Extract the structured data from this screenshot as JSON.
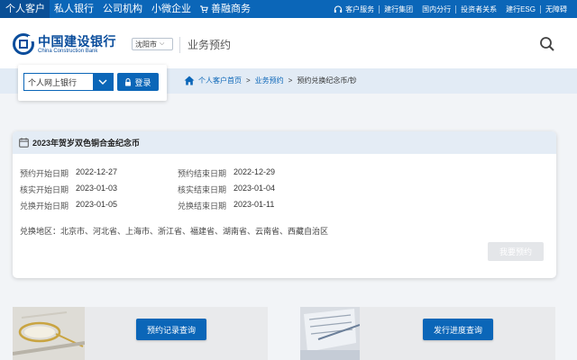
{
  "topnav": {
    "items": [
      "个人客户",
      "私人银行",
      "公司机构",
      "小微企业",
      "善融商务"
    ],
    "right_links": [
      "客户服务",
      "建行集团",
      "国内分行",
      "投资者关系",
      "建行ESG",
      "无障碍"
    ]
  },
  "header": {
    "logo_cn": "中国建设银行",
    "logo_en": "China Construction Bank",
    "city": "沈阳市",
    "section_title": "业务预约"
  },
  "login": {
    "select_value": "个人网上银行",
    "button_label": "登录"
  },
  "breadcrumb": [
    "个人客户首页",
    "业务预约",
    "预约兑换纪念币/钞"
  ],
  "card": {
    "title": "2023年贺岁双色铜合金纪念币",
    "rows": [
      {
        "label1": "预约开始日期",
        "value1": "2022-12-27",
        "label2": "预约结束日期",
        "value2": "2022-12-29"
      },
      {
        "label1": "核实开始日期",
        "value1": "2023-01-03",
        "label2": "核实结束日期",
        "value2": "2023-01-04"
      },
      {
        "label1": "兑换开始日期",
        "value1": "2023-01-05",
        "label2": "兑换结束日期",
        "value2": "2023-01-11"
      }
    ],
    "region_label": "兑换地区：",
    "regions": "北京市、河北省、上海市、浙江省、福建省、湖南省、云南省、西藏自治区",
    "reserve_button": "我要预约"
  },
  "panels": {
    "left_button": "预约记录查询",
    "right_button": "发行进度查询"
  },
  "colors": {
    "brand_blue": "#0b66b8",
    "band": "#e2ebf5",
    "disabled": "#e4e6e9"
  },
  "icons": [
    "user-icon",
    "cart-icon",
    "headset-icon",
    "lock-icon",
    "search-icon",
    "home-icon",
    "calendar-icon",
    "chevron-down-icon"
  ]
}
